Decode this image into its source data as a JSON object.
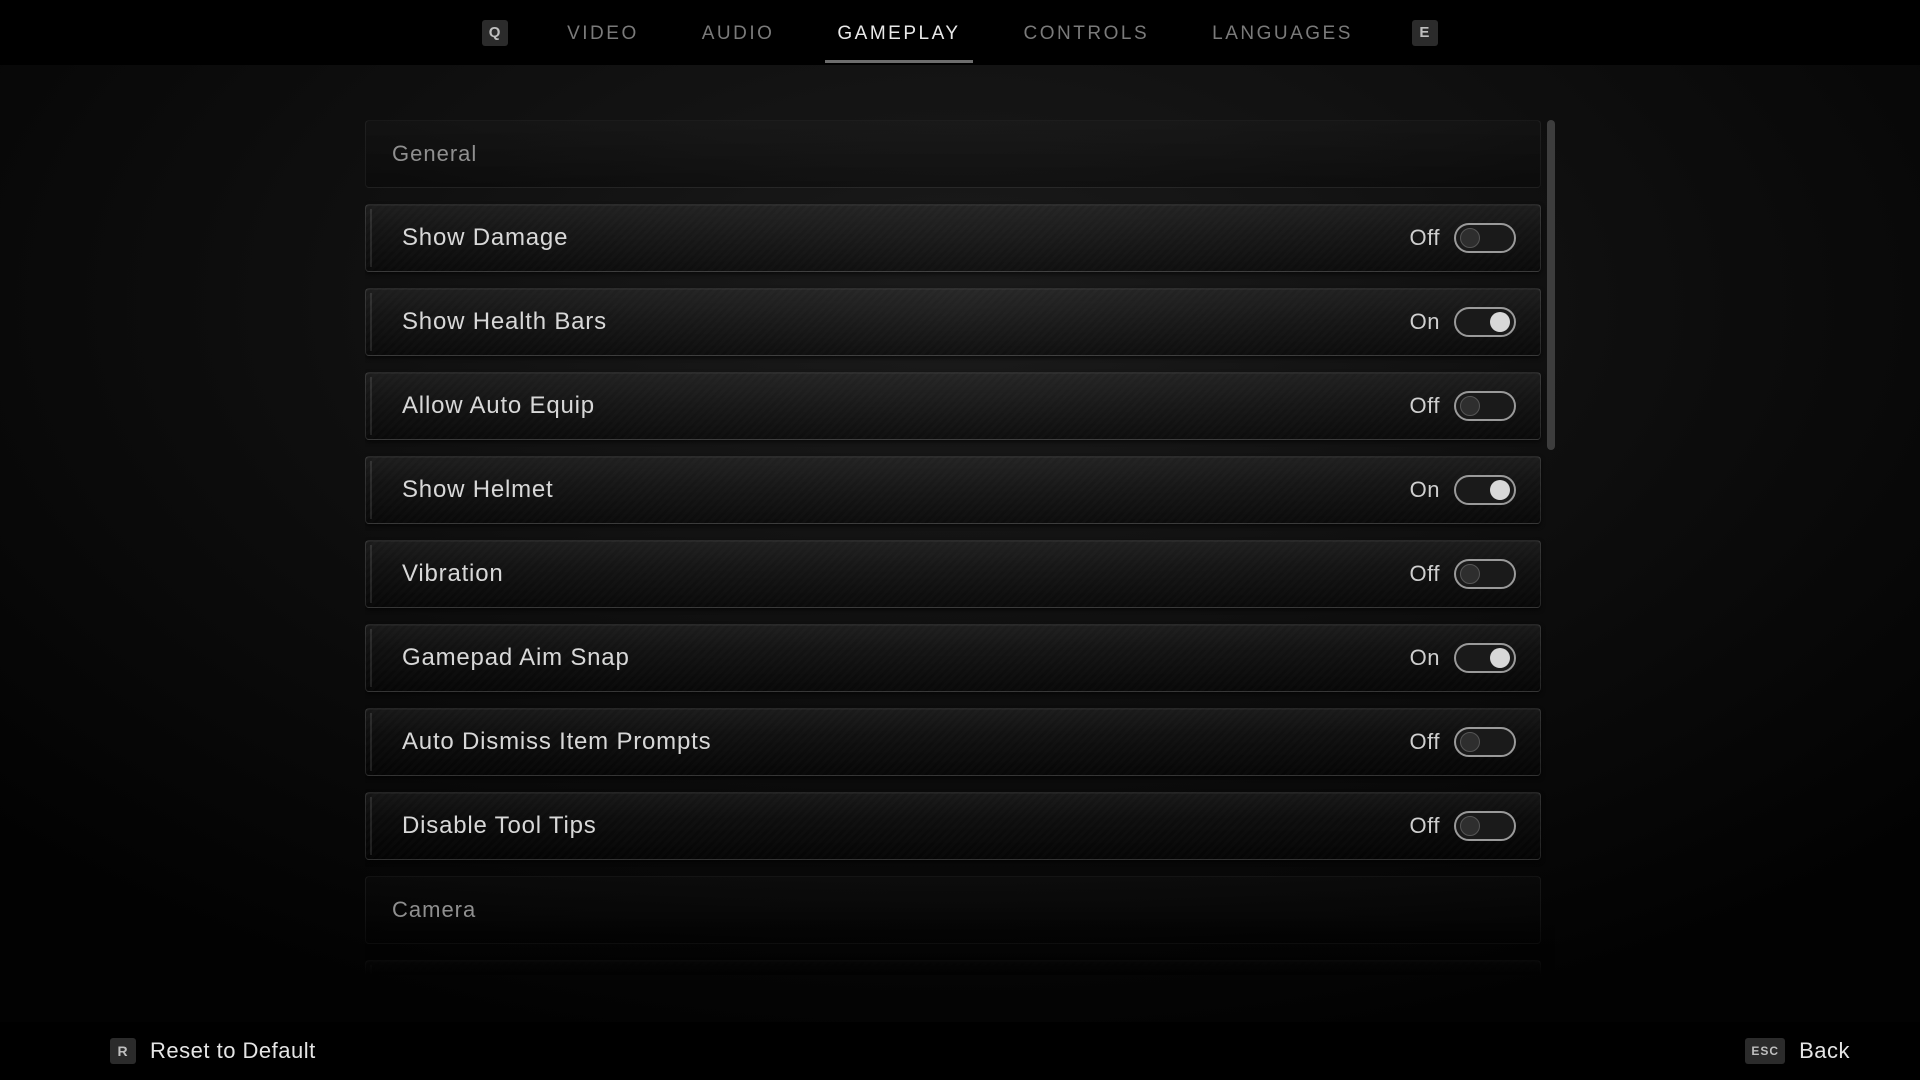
{
  "tabbar": {
    "prev_key": "Q",
    "next_key": "E",
    "tabs": [
      {
        "id": "video",
        "label": "VIDEO",
        "active": false
      },
      {
        "id": "audio",
        "label": "AUDIO",
        "active": false
      },
      {
        "id": "gameplay",
        "label": "GAMEPLAY",
        "active": true
      },
      {
        "id": "controls",
        "label": "CONTROLS",
        "active": false
      },
      {
        "id": "languages",
        "label": "LANGUAGES",
        "active": false
      }
    ]
  },
  "toggle_labels": {
    "on": "On",
    "off": "Off"
  },
  "sections": [
    {
      "title": "General",
      "rows": [
        {
          "label": "Show Damage",
          "on": false
        },
        {
          "label": "Show Health Bars",
          "on": true
        },
        {
          "label": "Allow Auto Equip",
          "on": false
        },
        {
          "label": "Show Helmet",
          "on": true
        },
        {
          "label": "Vibration",
          "on": false
        },
        {
          "label": "Gamepad Aim Snap",
          "on": true
        },
        {
          "label": "Auto Dismiss Item Prompts",
          "on": false
        },
        {
          "label": "Disable Tool Tips",
          "on": false
        }
      ]
    },
    {
      "title": "Camera",
      "rows": [
        {
          "label": "",
          "on": false
        }
      ]
    }
  ],
  "footer": {
    "reset_key": "R",
    "reset_label": "Reset to Default",
    "back_key": "ESC",
    "back_label": "Back"
  }
}
